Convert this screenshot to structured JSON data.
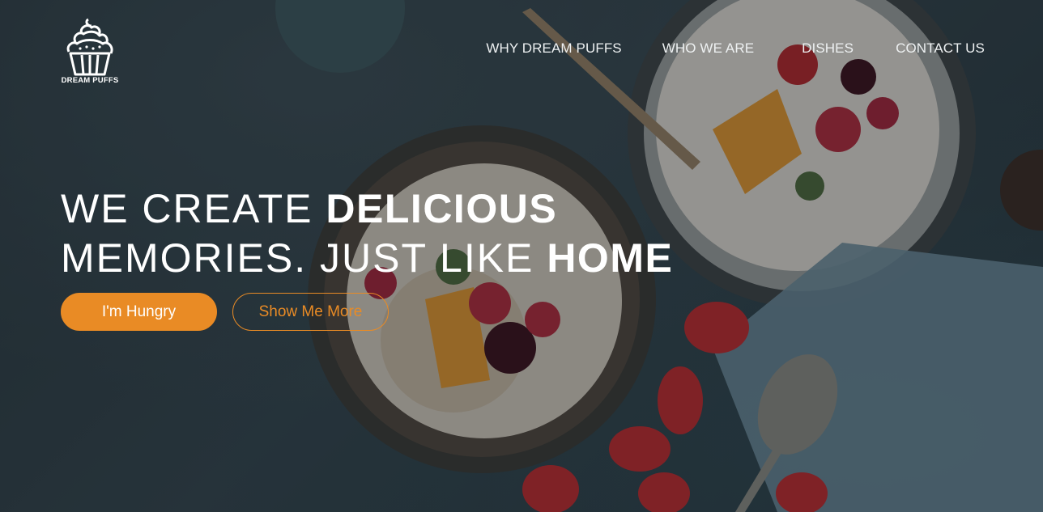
{
  "brand": {
    "name": "DREAM PUFFS"
  },
  "nav": {
    "items": [
      {
        "label": "WHY DREAM PUFFS"
      },
      {
        "label": "WHO WE ARE"
      },
      {
        "label": "DISHES"
      },
      {
        "label": "CONTACT US"
      }
    ]
  },
  "hero": {
    "line1_light": "WE CREATE ",
    "line1_bold": "DELICIOUS",
    "line2_light": "MEMORIES. JUST LIKE ",
    "line2_bold": "HOME",
    "primary_button": "I'm Hungry",
    "secondary_button": "Show Me More"
  },
  "colors": {
    "accent": "#e98b25",
    "text": "#ffffff"
  },
  "icons": {
    "logo": "cupcake-icon"
  }
}
